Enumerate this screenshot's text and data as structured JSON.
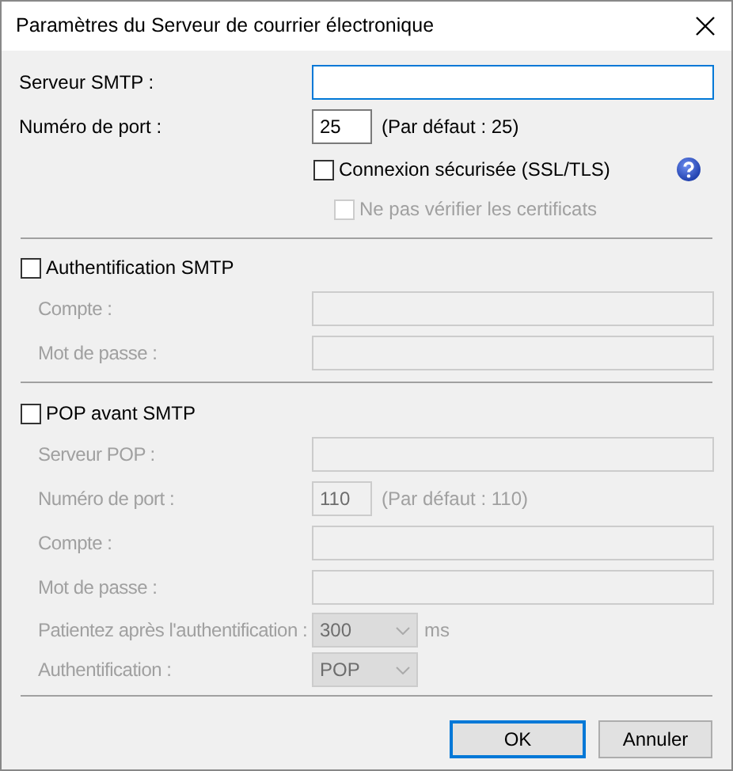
{
  "window": {
    "title": "Paramètres du Serveur de courrier électronique"
  },
  "sections": [
    {
      "rows": [
        {
          "kind": "text",
          "label": "Serveur SMTP :",
          "disabled": false,
          "focused": true
        },
        {
          "kind": "port",
          "label": "Numéro de port :",
          "value": "25",
          "hint": "(Par défaut : 25)",
          "disabled": false
        },
        {
          "kind": "check",
          "label": "Connexion sécurisée (SSL/TLS)",
          "checked": false,
          "disabled": false,
          "help": true,
          "children": [
            {
              "label": "Ne pas vérifier les certificats",
              "checked": false,
              "disabled": true
            }
          ]
        }
      ]
    },
    {
      "toggle": {
        "label": "Authentification SMTP",
        "checked": false
      },
      "rows": [
        {
          "kind": "text",
          "label": "Compte :",
          "disabled": true
        },
        {
          "kind": "text",
          "label": "Mot de passe :",
          "disabled": true
        }
      ]
    },
    {
      "toggle": {
        "label": "POP avant SMTP",
        "checked": false
      },
      "rows": [
        {
          "kind": "text",
          "label": "Serveur POP :",
          "disabled": true
        },
        {
          "kind": "port",
          "label": "Numéro de port :",
          "value": "110",
          "hint": "(Par défaut : 110)",
          "disabled": true
        },
        {
          "kind": "text",
          "label": "Compte :",
          "disabled": true
        },
        {
          "kind": "text",
          "label": "Mot de passe :",
          "disabled": true
        },
        {
          "kind": "select",
          "label": "Patientez après l'authentification :",
          "value": "300",
          "unit": "ms",
          "disabled": true
        },
        {
          "kind": "select",
          "label": "Authentification :",
          "value": "POP",
          "disabled": true
        }
      ]
    }
  ],
  "buttons": [
    {
      "label": "OK",
      "default": true
    },
    {
      "label": "Annuler",
      "default": false
    }
  ]
}
